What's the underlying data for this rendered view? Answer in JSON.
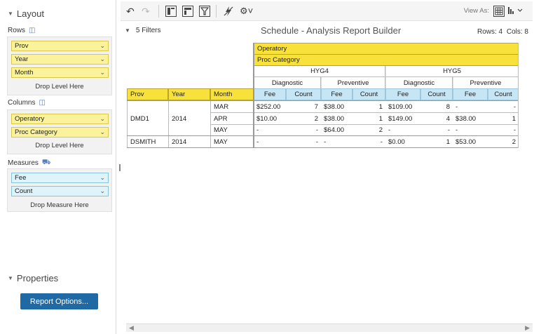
{
  "layout": {
    "title": "Layout",
    "rows_label": "Rows",
    "rows_chips": [
      "Prov",
      "Year",
      "Month"
    ],
    "rows_drop": "Drop Level Here",
    "columns_label": "Columns",
    "columns_chips": [
      "Operatory",
      "Proc Category"
    ],
    "columns_drop": "Drop Level Here",
    "measures_label": "Measures",
    "measures_chips": [
      "Fee",
      "Count"
    ],
    "measures_drop": "Drop Measure Here"
  },
  "properties": {
    "title": "Properties",
    "button": "Report Options..."
  },
  "toolbar": {
    "icons": [
      "undo-icon",
      "redo-icon",
      "layout-panel-icon",
      "table-panel-icon",
      "filter-icon",
      "lightning-off-icon",
      "settings-icon"
    ],
    "view_as_label": "View As:"
  },
  "header": {
    "filters": "5 Filters",
    "title": "Schedule - Analysis Report Builder",
    "rows": "Rows: 4",
    "cols": "Cols: 8"
  },
  "grid": {
    "col_dim1": "Operatory",
    "col_dim2": "Proc Category",
    "operatories": [
      "HYG4",
      "HYG5"
    ],
    "categories": [
      "Diagnostic",
      "Preventive",
      "Diagnostic",
      "Preventive"
    ],
    "measures": [
      "Fee",
      "Count",
      "Fee",
      "Count",
      "Fee",
      "Count",
      "Fee",
      "Count"
    ],
    "row_headers": [
      "Prov",
      "Year",
      "Month"
    ],
    "rows": [
      {
        "prov": "DMD1",
        "year": "2014",
        "month": "MAR",
        "values": [
          "$252.00",
          "7",
          "$38.00",
          "1",
          "$109.00",
          "8",
          "-",
          "-"
        ]
      },
      {
        "prov": "",
        "year": "",
        "month": "APR",
        "values": [
          "$10.00",
          "2",
          "$38.00",
          "1",
          "$149.00",
          "4",
          "$38.00",
          "1"
        ]
      },
      {
        "prov": "",
        "year": "",
        "month": "MAY",
        "values": [
          "-",
          "-",
          "$64.00",
          "2",
          "-",
          "-",
          "-",
          "-"
        ]
      },
      {
        "prov": "DSMITH",
        "year": "2014",
        "month": "MAY",
        "values": [
          "-",
          "-",
          "-",
          "-",
          "$0.00",
          "1",
          "$53.00",
          "2"
        ]
      }
    ]
  }
}
